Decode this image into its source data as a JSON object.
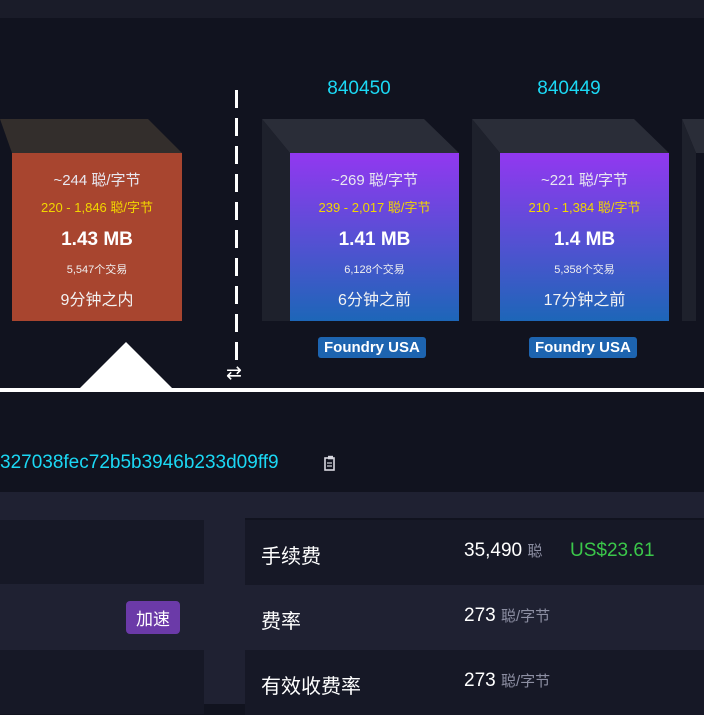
{
  "blocks": [
    {
      "median_fee": "~244 聪/字节",
      "fee_range": "220 - 1,846 聪/字节",
      "size": "1.43 MB",
      "tx_count": "5,547个交易",
      "time": "9分钟之内",
      "color": "#a8452f"
    },
    {
      "height": "840450",
      "median_fee": "~269 聪/字节",
      "fee_range": "239 - 2,017 聪/字节",
      "size": "1.41 MB",
      "tx_count": "6,128个交易",
      "time": "6分钟之前",
      "pool": "Foundry USA"
    },
    {
      "height": "840449",
      "median_fee": "~221 聪/字节",
      "fee_range": "210 - 1,384 聪/字节",
      "size": "1.4 MB",
      "tx_count": "5,358个交易",
      "time": "17分钟之前",
      "pool": "Foundry USA"
    }
  ],
  "swap_icon": "⇄",
  "txid": "327038fec72b5b3946b233d09ff9",
  "left_table": {
    "accelerate_label": "加速"
  },
  "right_table": {
    "rows": [
      {
        "label": "手续费",
        "value": "35,490",
        "unit": "聪",
        "usd": "US$23.61"
      },
      {
        "label": "费率",
        "value": "273",
        "unit": "聪/字节"
      },
      {
        "label": "有效收费率",
        "value": "273",
        "unit": "聪/字节"
      }
    ]
  },
  "colors": {
    "background": "#11131f",
    "accent_cyan": "#1bd8f4",
    "usd_green": "#3bc74a",
    "range_yellow": "#f2d600"
  }
}
